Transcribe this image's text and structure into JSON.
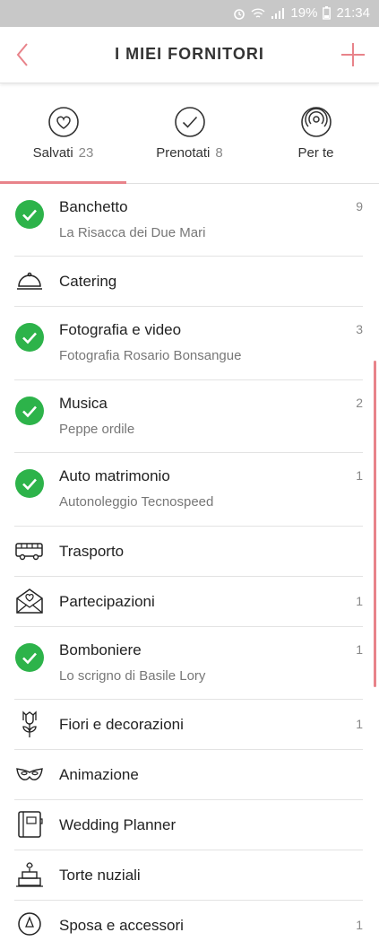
{
  "status_bar": {
    "battery": "19%",
    "time": "21:34"
  },
  "header": {
    "title": "I MIEI FORNITORI"
  },
  "tabs": [
    {
      "label": "Salvati",
      "count": "23",
      "icon": "heart-circle-icon"
    },
    {
      "label": "Prenotati",
      "count": "8",
      "icon": "check-circle-icon"
    },
    {
      "label": "Per te",
      "count": "",
      "icon": "signal-circle-icon"
    }
  ],
  "vendors": [
    {
      "title": "Banchetto",
      "subtitle": "La Risacca dei Due Mari",
      "count": "9",
      "icon": "check-badge-icon"
    },
    {
      "title": "Catering",
      "subtitle": "",
      "count": "",
      "icon": "cloche-icon"
    },
    {
      "title": "Fotografia e video",
      "subtitle": "Fotografia Rosario Bonsangue",
      "count": "3",
      "icon": "check-badge-icon"
    },
    {
      "title": "Musica",
      "subtitle": "Peppe ordile",
      "count": "2",
      "icon": "check-badge-icon"
    },
    {
      "title": "Auto matrimonio",
      "subtitle": "Autonoleggio Tecnospeed",
      "count": "1",
      "icon": "check-badge-icon"
    },
    {
      "title": "Trasporto",
      "subtitle": "",
      "count": "",
      "icon": "bus-icon"
    },
    {
      "title": "Partecipazioni",
      "subtitle": "",
      "count": "1",
      "icon": "envelope-heart-icon"
    },
    {
      "title": "Bomboniere",
      "subtitle": "Lo scrigno di Basile Lory",
      "count": "1",
      "icon": "check-badge-icon"
    },
    {
      "title": "Fiori e decorazioni",
      "subtitle": "",
      "count": "1",
      "icon": "flower-icon"
    },
    {
      "title": "Animazione",
      "subtitle": "",
      "count": "",
      "icon": "mask-icon"
    },
    {
      "title": "Wedding Planner",
      "subtitle": "",
      "count": "",
      "icon": "planner-icon"
    },
    {
      "title": "Torte nuziali",
      "subtitle": "",
      "count": "",
      "icon": "cake-icon"
    },
    {
      "title": "Sposa e accessori",
      "subtitle": "",
      "count": "1",
      "icon": "dress-icon"
    }
  ],
  "colors": {
    "accent": "#e8838a",
    "check": "#2db34a"
  }
}
